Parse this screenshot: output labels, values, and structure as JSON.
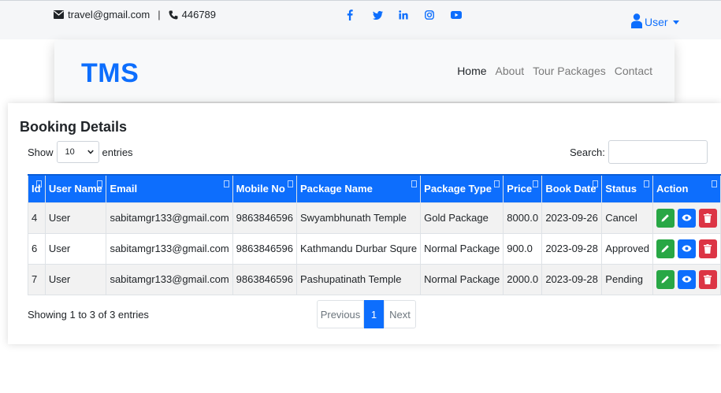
{
  "topbar": {
    "email": "travel@gmail.com",
    "separator": "|",
    "phone": "446789",
    "social": [
      "facebook-icon",
      "twitter-icon",
      "linkedin-icon",
      "instagram-icon",
      "youtube-icon"
    ],
    "user_label": "User"
  },
  "navbar": {
    "brand": "TMS",
    "links": [
      "Home",
      "About",
      "Tour Packages",
      "Contact"
    ],
    "active": "Home"
  },
  "booking": {
    "title": "Booking Details",
    "show_label": "Show",
    "entries_value": "10",
    "entries_label": "entries",
    "search_label": "Search:",
    "search_value": "",
    "columns": [
      "Id",
      "User Name",
      "Email",
      "Mobile No",
      "Package Name",
      "Package Type",
      "Price",
      "Book Date",
      "Status",
      "Action"
    ],
    "rows": [
      {
        "id": "4",
        "user": "User",
        "email": "sabitamgr133@gmail.com",
        "mobile": "9863846596",
        "package": "Swyambhunath Temple",
        "type": "Gold Package",
        "price": "8000.0",
        "date": "2023-09-26",
        "status": "Cancel"
      },
      {
        "id": "6",
        "user": "User",
        "email": "sabitamgr133@gmail.com",
        "mobile": "9863846596",
        "package": "Kathmandu Durbar Squre",
        "type": "Normal Package",
        "price": "900.0",
        "date": "2023-09-28",
        "status": "Approved"
      },
      {
        "id": "7",
        "user": "User",
        "email": "sabitamgr133@gmail.com",
        "mobile": "9863846596",
        "package": "Pashupatinath Temple",
        "type": "Normal Package",
        "price": "2000.0",
        "date": "2023-09-28",
        "status": "Pending"
      }
    ],
    "info": "Showing 1 to 3 of 3 entries",
    "pagination": {
      "previous": "Previous",
      "current": "1",
      "next": "Next"
    }
  },
  "colors": {
    "primary": "#0d6efd",
    "success": "#28a745",
    "danger": "#dc3545"
  }
}
